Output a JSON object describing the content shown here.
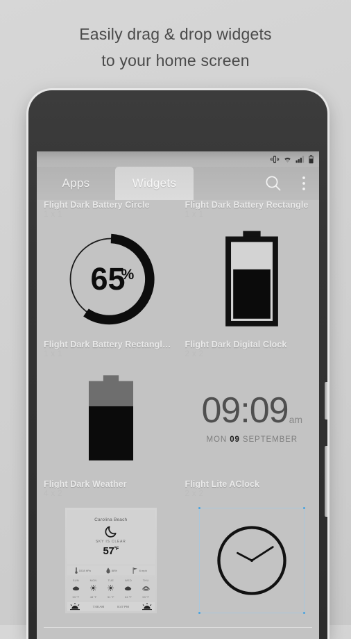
{
  "headline": {
    "line1": "Easily drag & drop widgets",
    "line2": "to your home screen"
  },
  "statusbar": {
    "icons": [
      "vibrate-icon",
      "wifi-icon",
      "signal-icon",
      "battery-icon"
    ]
  },
  "tabs": [
    {
      "label": "Apps",
      "active": false
    },
    {
      "label": "Widgets",
      "active": true
    }
  ],
  "actions": [
    {
      "name": "search-icon",
      "label": "Search"
    },
    {
      "name": "overflow-menu-icon",
      "label": "More options"
    }
  ],
  "widgets": [
    {
      "title": "Flight Dark Battery Circle",
      "size": "1 x 1",
      "preview": "battery-circle"
    },
    {
      "title": "Flight Dark Battery Rectangle",
      "size": "1 x 1",
      "preview": "battery-outline"
    },
    {
      "title": "Flight Dark Battery Rectangl…",
      "size": "1 x 1",
      "preview": "battery-solid"
    },
    {
      "title": "Flight Dark Digital Clock",
      "size": "2 x 2",
      "preview": "digital-clock"
    },
    {
      "title": "Flight Dark Weather",
      "size": "4 x 2",
      "preview": "weather"
    },
    {
      "title": "Flight Lite AClock",
      "size": "2 x 2",
      "preview": "analog-clock"
    }
  ],
  "battery": {
    "percent": "65",
    "percent_symbol": "%",
    "level": 65
  },
  "clock": {
    "time": "09:09",
    "meridiem": "am",
    "day": "MON",
    "date": "09",
    "month": "SEPTEMBER"
  },
  "weather": {
    "city": "Carolina Beach",
    "condition": "SKY IS CLEAR",
    "temp": "57",
    "unit": "°F",
    "icon": "moon-icon",
    "details": [
      {
        "icon": "pressure-icon",
        "value": "1018 hPa"
      },
      {
        "icon": "humidity-icon",
        "value": "88%"
      },
      {
        "icon": "wind-icon",
        "value": "6 mph"
      }
    ],
    "forecast": [
      {
        "day": "SUN",
        "icon": "cloud-icon",
        "temp": "53 °F"
      },
      {
        "day": "MON",
        "icon": "sun-icon",
        "temp": "48 °F"
      },
      {
        "day": "TUE",
        "icon": "sun-icon",
        "temp": "51 °F"
      },
      {
        "day": "WED",
        "icon": "cloud-icon",
        "temp": "64 °F"
      },
      {
        "day": "THU",
        "icon": "cloud-icon",
        "temp": "53 °F"
      }
    ],
    "sunrise": "7:08 AM",
    "sunset": "8:47 PM"
  },
  "colors": {
    "accent": "#4aa3df",
    "ink": "#111111",
    "screen_bg": "#c3c3c3",
    "tab_active": "#d8d8d8"
  }
}
